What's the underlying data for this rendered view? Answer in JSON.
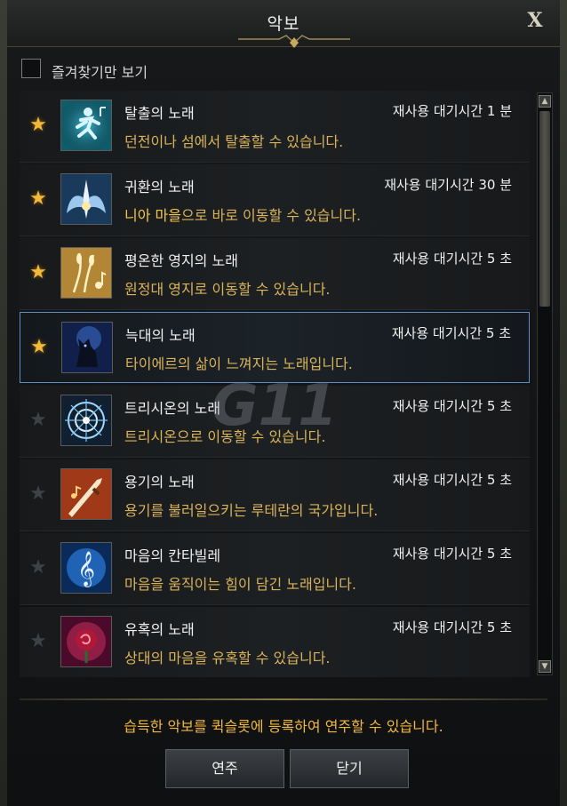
{
  "window": {
    "title": "악보",
    "close_label": "X"
  },
  "filter": {
    "favorites_only_label": "즐겨찾기만 보기",
    "checked": false
  },
  "songs": [
    {
      "name": "탈출의 노래",
      "cooldown": "재사용 대기시간 1 분",
      "description": "던전이나 섬에서 탈출할 수 있습니다.",
      "favorite": true,
      "icon": "running-man-icon"
    },
    {
      "name": "귀환의 노래",
      "cooldown": "재사용 대기시간 30 분",
      "description_highlight": "니아 마을",
      "description_rest": "으로 바로 이동할 수 있습니다.",
      "favorite": true,
      "icon": "winged-return-icon"
    },
    {
      "name": "평온한 영지의 노래",
      "cooldown": "재사용 대기시간 5 초",
      "description": "원정대 영지로 이동할 수 있습니다.",
      "favorite": true,
      "icon": "wheat-note-icon"
    },
    {
      "name": "늑대의 노래",
      "cooldown": "재사용 대기시간 5 초",
      "description": "타이에르의 삶이 느껴지는 노래입니다.",
      "favorite": true,
      "selected": true,
      "icon": "wolf-icon"
    },
    {
      "name": "트리시온의 노래",
      "cooldown": "재사용 대기시간 5 초",
      "description": "트리시온으로 이동할 수 있습니다.",
      "favorite": false,
      "icon": "portal-circle-icon"
    },
    {
      "name": "용기의 노래",
      "cooldown": "재사용 대기시간 5 초",
      "description": "용기를 불러일으키는 루테란의 국가입니다.",
      "favorite": false,
      "icon": "sword-note-icon"
    },
    {
      "name": "마음의 칸타빌레",
      "cooldown": "재사용 대기시간 5 초",
      "description": "마음을 움직이는 힘이 담긴 노래입니다.",
      "favorite": false,
      "icon": "treble-clef-icon"
    },
    {
      "name": "유혹의 노래",
      "cooldown": "재사용 대기시간 5 초",
      "description": "상대의 마음을 유혹할 수 있습니다.",
      "favorite": false,
      "icon": "rose-icon"
    }
  ],
  "footer": {
    "hint": "습득한 악보를 퀵슬롯에 등록하여 연주할 수 있습니다.",
    "play_label": "연주",
    "close_label": "닫기"
  },
  "watermark": "G11",
  "colors": {
    "star_on": "#f2b93b",
    "star_off": "#3e4246",
    "description": "#d9b35a",
    "hint": "#f2b83c",
    "selected_border": "#5c8ec0"
  }
}
